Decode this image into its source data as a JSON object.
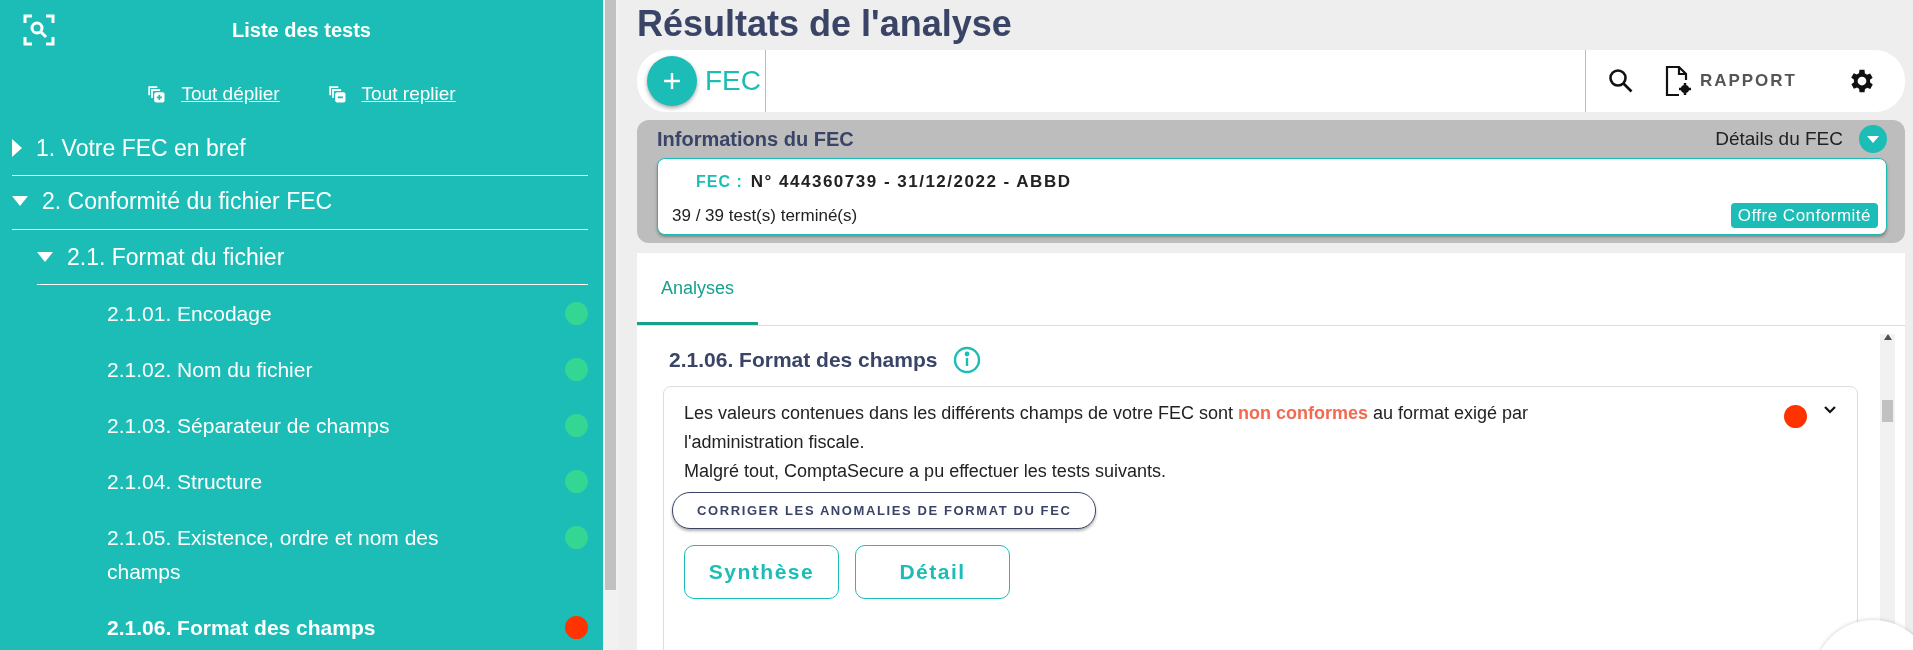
{
  "sidebar": {
    "title": "Liste des tests",
    "links": [
      {
        "kind": "expand",
        "label": "Tout déplier"
      },
      {
        "kind": "collapse",
        "label": "Tout replier"
      }
    ],
    "tree": [
      {
        "label": "1. Votre FEC en bref",
        "expanded": false
      },
      {
        "label": "2. Conformité du fichier FEC",
        "expanded": true,
        "children": [
          {
            "label": "2.1. Format du fichier",
            "expanded": true,
            "children": [
              {
                "label": "2.1.01. Encodage",
                "color": "#34d693",
                "selected": false
              },
              {
                "label": "2.1.02. Nom du fichier",
                "color": "#34d693",
                "selected": false
              },
              {
                "label": "2.1.03. Séparateur de champs",
                "color": "#34d693",
                "selected": false
              },
              {
                "label": "2.1.04. Structure",
                "color": "#34d693",
                "selected": false
              },
              {
                "label": "2.1.05. Existence, ordre et nom des champs",
                "color": "#34d693",
                "selected": false
              },
              {
                "label": "2.1.06. Format des champs",
                "color": "#ff3300",
                "selected": true
              }
            ]
          }
        ]
      }
    ]
  },
  "page_title": "Résultats de l'analyse",
  "toolbar": {
    "fec_label": "FEC",
    "report_label": "RAPPORT"
  },
  "info_panel": {
    "title": "Informations du FEC",
    "details_label": "Détails du FEC",
    "fec_prefix": "FEC :",
    "fec_value": "N° 444360739 - 31/12/2022 - ABBD",
    "progress": "39 / 39 test(s) terminé(s)",
    "offer_badge": "Offre Conformité"
  },
  "tabs": [
    {
      "label": "Analyses",
      "selected": true
    }
  ],
  "section": {
    "title": "2.1.06. Format des champs",
    "status": {
      "color": "#ff3300"
    },
    "message": [
      "Les valeurs contenues dans les différents champs de votre FEC sont **non conformes** au format exigé par l'administration fiscale.",
      "Malgré tout, ComptaSecure a pu effectuer les tests suivants."
    ],
    "fix_button": "CORRIGER LES ANOMALIES DE FORMAT DU FEC",
    "view_buttons": [
      "Synthèse",
      "Détail"
    ]
  }
}
